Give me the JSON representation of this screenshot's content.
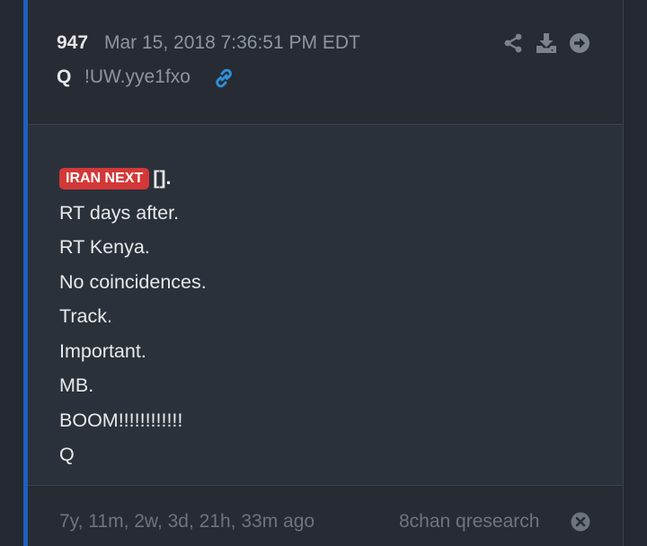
{
  "post": {
    "number": "947",
    "date": "Mar 15, 2018 7:36:51 PM EDT",
    "author": "Q",
    "tripcode": "!UW.yye1fxo"
  },
  "header_actions": {
    "icons": [
      "share-icon",
      "download-icon",
      "arrow-right-circle-icon"
    ]
  },
  "message": {
    "tag": "IRAN NEXT",
    "first_line_rest": "[].",
    "lines": [
      "RT days after.",
      "RT Kenya.",
      "No coincidences.",
      "Track.",
      "Important.",
      "MB.",
      "BOOM!!!!!!!!!!!!",
      "Q"
    ]
  },
  "footer": {
    "age": "7y, 11m, 2w, 3d, 21h, 33m ago",
    "source": "8chan qresearch"
  },
  "colors": {
    "accent": "#1f5fbf",
    "tag": "#d33838",
    "link": "#2f8fd6"
  }
}
